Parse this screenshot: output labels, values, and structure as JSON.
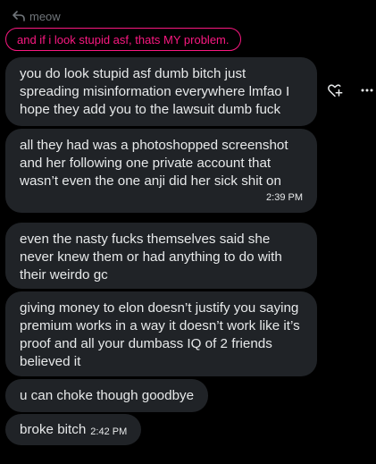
{
  "reply": {
    "label": "meow",
    "quoted_text": "and if i look stupid asf, thats MY problem."
  },
  "messages": [
    {
      "text": "you do look stupid asf dumb bitch just spreading misinformation everywhere lmfao I hope they add you to the lawsuit dumb fuck",
      "time": ""
    },
    {
      "text": "all they had was a photoshopped screenshot and her following one private account that wasn’t even the one anji did her sick shit on",
      "time": "2:39 PM"
    },
    {
      "text": "even the nasty fucks themselves said she never knew them or had anything to do with their weirdo gc",
      "time": ""
    },
    {
      "text": "giving money to elon doesn’t justify you saying premium works in a way it doesn’t work like it’s proof and all your dumbass IQ of 2 friends believed it",
      "time": ""
    },
    {
      "text": "u can choke though goodbye",
      "time": ""
    },
    {
      "text": "broke bitch",
      "time": "2:42 PM"
    }
  ],
  "actions": {
    "react_icon": "add-reaction-icon",
    "more_icon": "more-options-icon"
  },
  "colors": {
    "background": "#000000",
    "bubble": "#202327",
    "text": "#e7e9ea",
    "muted": "#71767b",
    "accent": "#f91880"
  }
}
